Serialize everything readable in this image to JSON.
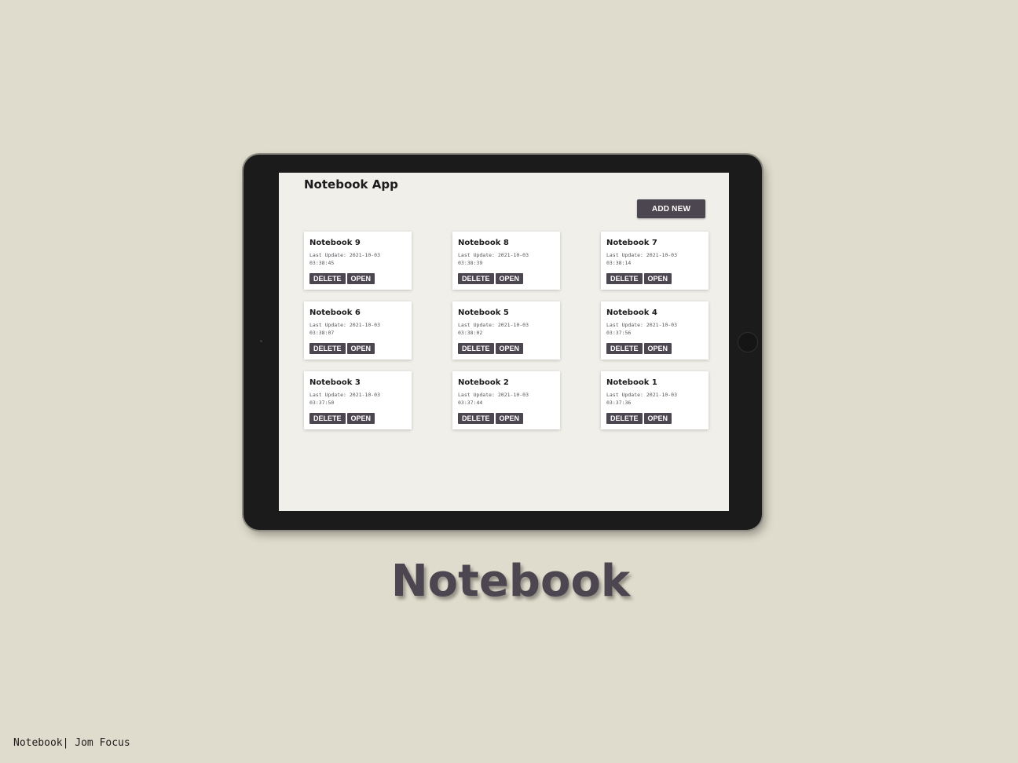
{
  "app": {
    "title": "Notebook App",
    "add_new_label": "ADD NEW"
  },
  "notebooks": [
    {
      "title": "Notebook 9",
      "meta": "Last Update: 2021-10-03 03:38:45",
      "delete_label": "DELETE",
      "open_label": "OPEN"
    },
    {
      "title": "Notebook 8",
      "meta": "Last Update: 2021-10-03 03:38:39",
      "delete_label": "DELETE",
      "open_label": "OPEN"
    },
    {
      "title": "Notebook 7",
      "meta": "Last Update: 2021-10-03 03:38:14",
      "delete_label": "DELETE",
      "open_label": "OPEN"
    },
    {
      "title": "Notebook 6",
      "meta": "Last Update: 2021-10-03 03:38:07",
      "delete_label": "DELETE",
      "open_label": "OPEN"
    },
    {
      "title": "Notebook 5",
      "meta": "Last Update: 2021-10-03 03:38:02",
      "delete_label": "DELETE",
      "open_label": "OPEN"
    },
    {
      "title": "Notebook 4",
      "meta": "Last Update: 2021-10-03 03:37:56",
      "delete_label": "DELETE",
      "open_label": "OPEN"
    },
    {
      "title": "Notebook 3",
      "meta": "Last Update: 2021-10-03 03:37:50",
      "delete_label": "DELETE",
      "open_label": "OPEN"
    },
    {
      "title": "Notebook 2",
      "meta": "Last Update: 2021-10-03 03:37:44",
      "delete_label": "DELETE",
      "open_label": "OPEN"
    },
    {
      "title": "Notebook 1",
      "meta": "Last Update: 2021-10-03 03:37:36",
      "delete_label": "DELETE",
      "open_label": "OPEN"
    }
  ],
  "hero_title": "Notebook",
  "footer_text": "Notebook| Jom Focus",
  "colors": {
    "background": "#e0dccd",
    "screen": "#f1efe9",
    "accent": "#4c4650",
    "tablet_frame": "#1c1b1b"
  }
}
